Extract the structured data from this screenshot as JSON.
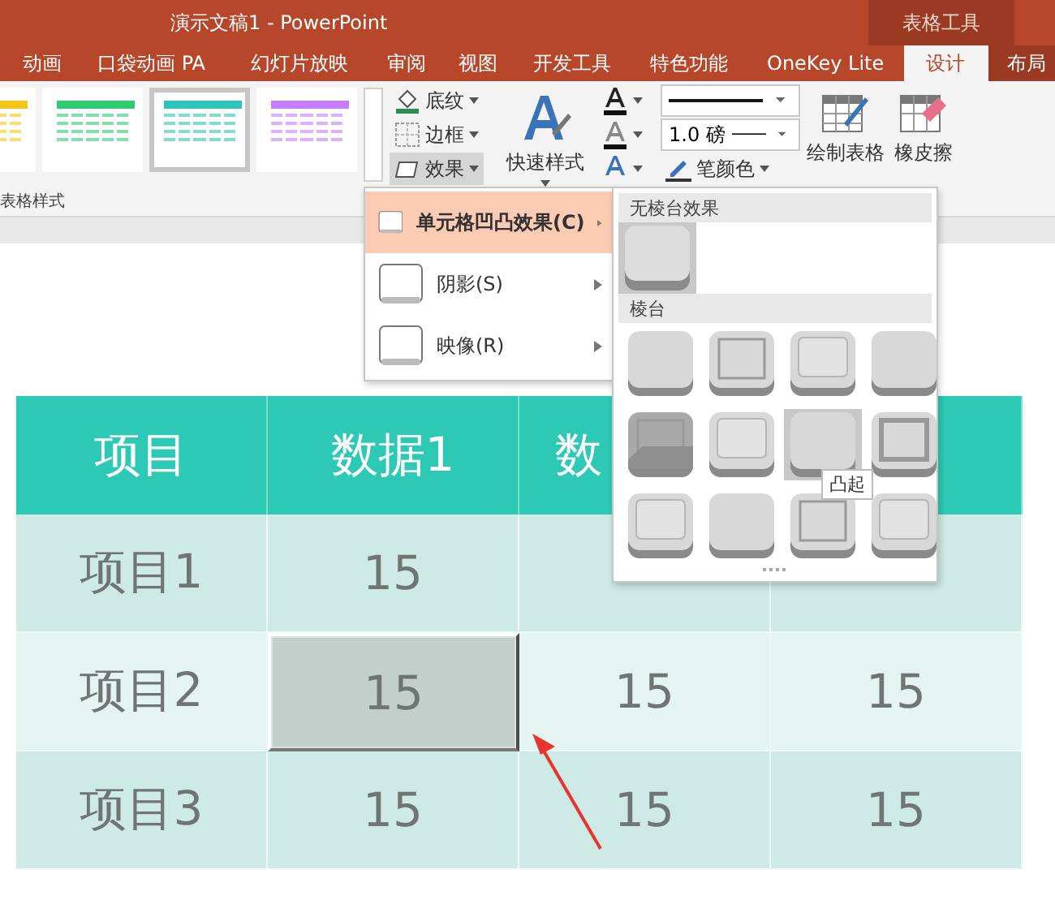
{
  "window": {
    "title": "演示文稿1 - PowerPoint",
    "context_tab": "表格工具"
  },
  "tabs": [
    {
      "label": "动画",
      "selected": false
    },
    {
      "label": "口袋动画 PA",
      "selected": false
    },
    {
      "label": "幻灯片放映",
      "selected": false
    },
    {
      "label": "审阅",
      "selected": false
    },
    {
      "label": "视图",
      "selected": false
    },
    {
      "label": "开发工具",
      "selected": false
    },
    {
      "label": "特色功能",
      "selected": false
    },
    {
      "label": "OneKey Lite",
      "selected": false
    },
    {
      "label": "设计",
      "selected": true
    },
    {
      "label": "布局",
      "selected": false
    }
  ],
  "ribbon": {
    "styles_gallery": [
      {
        "color": "#f5c518",
        "selected": false
      },
      {
        "color": "#2ecc71",
        "selected": false
      },
      {
        "color": "#2ec4b6",
        "selected": true
      },
      {
        "color": "#c77dff",
        "selected": false
      }
    ],
    "shading": "底纹",
    "borders": "边框",
    "effects": "效果",
    "effects_open": true,
    "quick_styles": "快速样式",
    "pen_weight": "1.0 磅",
    "pen_color": "笔颜色",
    "draw_table": "绘制表格",
    "eraser": "橡皮擦",
    "group_label": "表格样式"
  },
  "effects_menu": [
    {
      "label": "单元格凹凸效果(C)",
      "selected": true
    },
    {
      "label": "阴影(S)",
      "selected": false
    },
    {
      "label": "映像(R)",
      "selected": false
    }
  ],
  "bevel_menu": {
    "none_heading": "无棱台效果",
    "none_selected": true,
    "bevel_heading": "棱台",
    "tooltip": "凸起",
    "bevels": [
      {
        "selected": false
      },
      {
        "selected": false
      },
      {
        "selected": false
      },
      {
        "selected": false
      },
      {
        "selected": false
      },
      {
        "selected": false
      },
      {
        "selected": true
      },
      {
        "selected": false
      },
      {
        "selected": false
      },
      {
        "selected": false
      },
      {
        "selected": false
      },
      {
        "selected": false
      }
    ]
  },
  "table": {
    "header": [
      {
        "text": "项目",
        "kind": "full"
      },
      {
        "text": "数据1",
        "kind": "full"
      },
      {
        "text": "数",
        "kind": "cut"
      },
      {
        "kind": "hidden"
      }
    ],
    "rows": [
      [
        {
          "text": "项目1",
          "kind": "full",
          "selected": false
        },
        {
          "text": "15",
          "kind": "full",
          "selected": false
        },
        {
          "kind": "hidden",
          "selected": false
        },
        {
          "kind": "hidden",
          "selected": false
        }
      ],
      [
        {
          "text": "项目2",
          "kind": "full",
          "selected": false
        },
        {
          "text": "15",
          "kind": "full",
          "selected": true
        },
        {
          "text": "15",
          "kind": "full",
          "selected": false
        },
        {
          "text": "15",
          "kind": "full",
          "selected": false
        }
      ],
      [
        {
          "text": "项目3",
          "kind": "full",
          "selected": false
        },
        {
          "text": "15",
          "kind": "full",
          "selected": false
        },
        {
          "text": "15",
          "kind": "full",
          "selected": false
        },
        {
          "text": "15",
          "kind": "full",
          "selected": false
        }
      ]
    ]
  }
}
